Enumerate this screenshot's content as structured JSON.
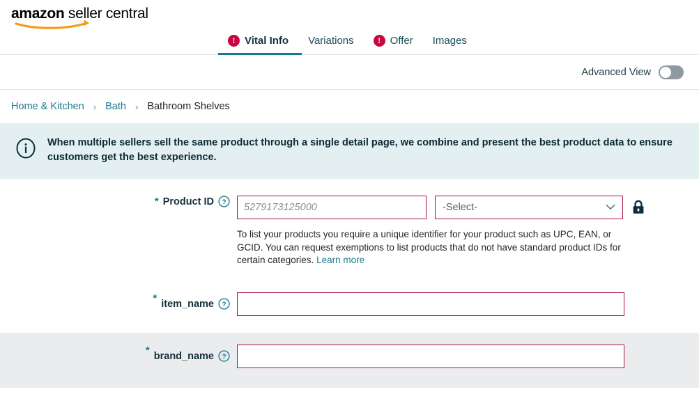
{
  "brand": {
    "logo_primary": "amazon",
    "logo_secondary": " seller central",
    "accent_teal": "#0e7c8f",
    "error_red": "#c7063f",
    "input_border_red": "#a8123f",
    "banner_bg": "#e4eff2",
    "shaded_row_bg": "#ebeced"
  },
  "tabs": [
    {
      "label": "Vital Info",
      "active": true,
      "has_error": true
    },
    {
      "label": "Variations",
      "active": false,
      "has_error": false
    },
    {
      "label": "Offer",
      "active": false,
      "has_error": true
    },
    {
      "label": "Images",
      "active": false,
      "has_error": false
    }
  ],
  "advanced_view": {
    "label": "Advanced View",
    "enabled": false
  },
  "breadcrumb": {
    "separator": "›",
    "items": [
      {
        "label": "Home & Kitchen",
        "is_link": true
      },
      {
        "label": "Bath",
        "is_link": true
      },
      {
        "label": "Bathroom Shelves",
        "is_link": false
      }
    ]
  },
  "banner": {
    "icon": "info-circle-icon",
    "message": "When multiple sellers sell the same product through a single detail page, we combine and present the best product data to ensure customers get the best experience."
  },
  "form": {
    "product_id": {
      "label": "Product ID",
      "required_marker": "*",
      "help_icon": "help-circle-icon",
      "value": "",
      "placeholder": "5279173125000",
      "select_value": "-Select-",
      "lock_icon": "lock-closed-icon",
      "helper_text": "To list your products you require a unique identifier for your product such as UPC, EAN, or GCID. You can request exemptions to list products that do not have standard product IDs for certain categories.",
      "learn_more": "Learn more"
    },
    "item_name": {
      "label": "item_name",
      "required_marker": "*",
      "help_icon": "help-circle-icon",
      "value": "",
      "placeholder": ""
    },
    "brand_name": {
      "label": "brand_name",
      "required_marker": "*",
      "help_icon": "help-circle-icon",
      "value": "",
      "placeholder": ""
    }
  }
}
